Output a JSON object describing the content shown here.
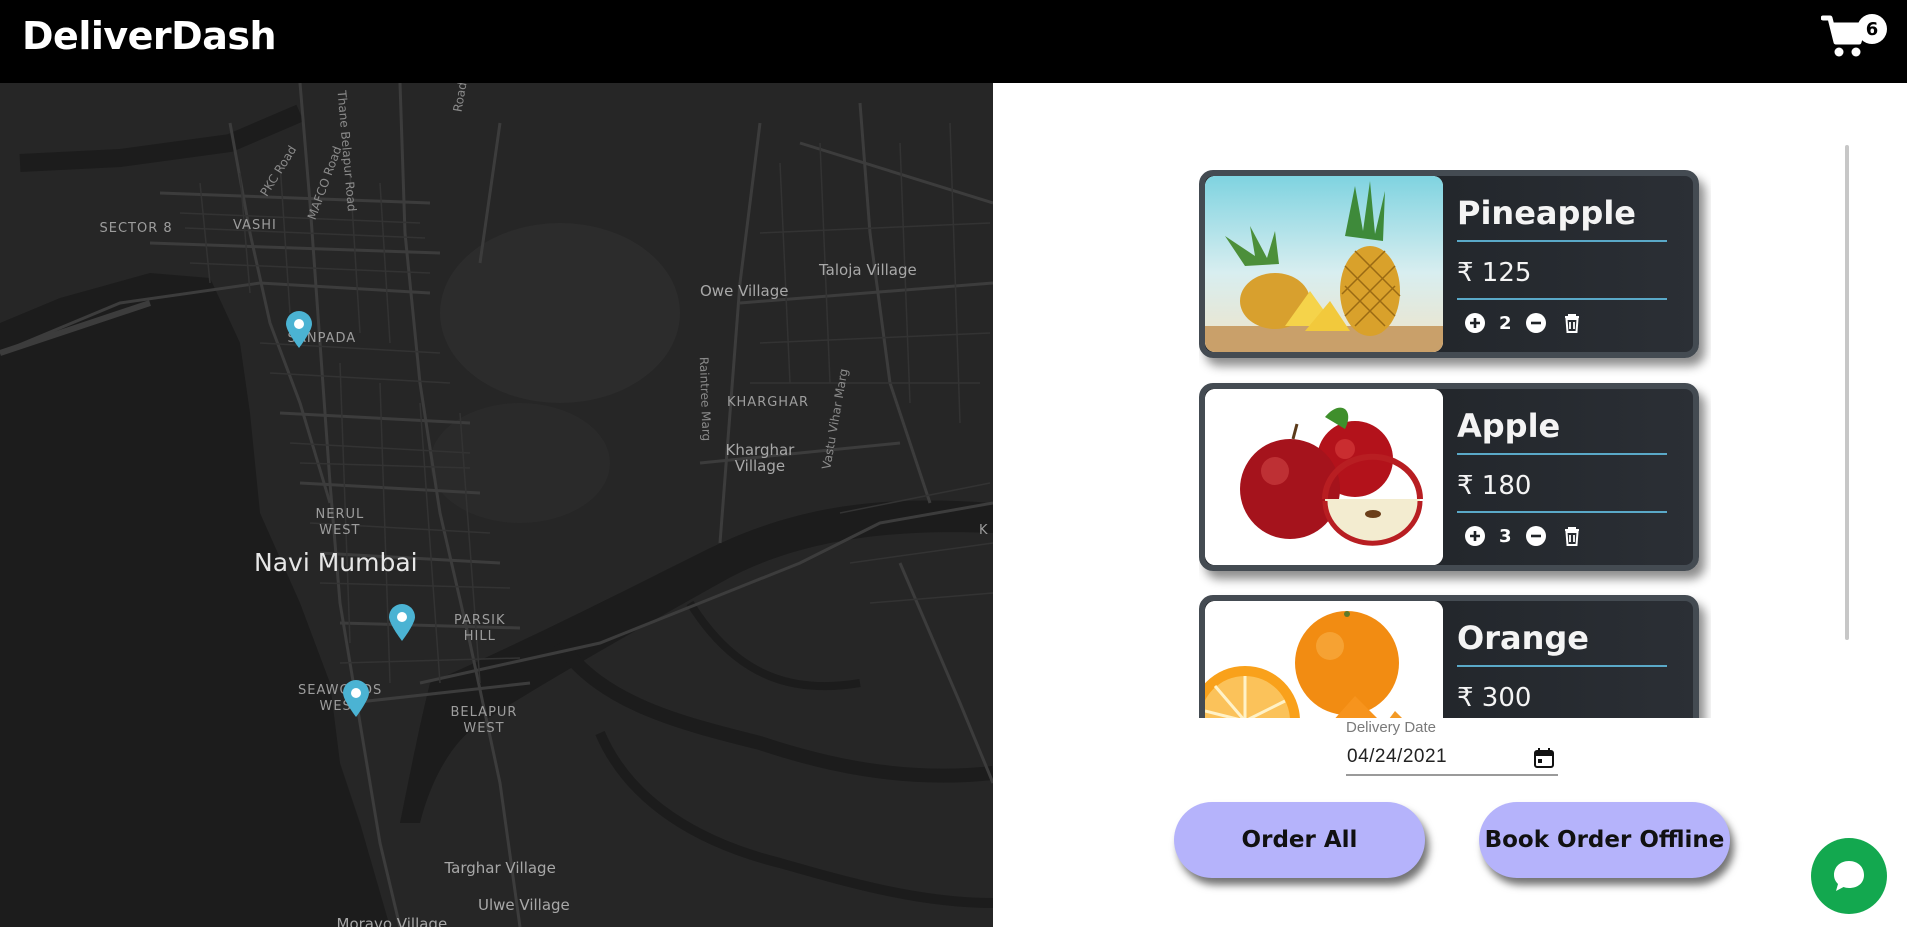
{
  "header": {
    "brand": "DeliverDash",
    "cart_count": "6"
  },
  "map": {
    "labels": {
      "sector8": "SECTOR 8",
      "vashi": "VASHI",
      "sanpada": "SANPADA",
      "nerul_line1": "NERUL",
      "nerul_line2": "WEST",
      "navi_mumbai": "Navi Mumbai",
      "parsik_line1": "PARSIK",
      "parsik_line2": "HILL",
      "seawoods_line1": "SEAWOODS",
      "seawoods_line2": "WEST",
      "belapur_line1": "BELAPUR",
      "belapur_line2": "WEST",
      "owe_village": "Owe Village",
      "taloja_village": "Taloja Village",
      "kharghar": "KHARGHAR",
      "kharghar_village_line1": "Kharghar",
      "kharghar_village_line2": "Village",
      "targhar_village": "Targhar Village",
      "ulwe_village": "Ulwe Village",
      "moravo_village": "Moravo Village",
      "pkc_road": "PKC Road",
      "mafco_road": "MAFCO Road",
      "thane_belapur_road": "Thane Belapur Road",
      "raintree_marg": "Raintree Marg",
      "vastu_vihar_marg": "Vastu Vihar Marg",
      "road_top": "Road",
      "edge_k": "K"
    }
  },
  "cart_items": [
    {
      "name": "Pineapple",
      "price": "₹ 125",
      "quantity": "2",
      "image": "pineapple-photo"
    },
    {
      "name": "Apple",
      "price": "₹ 180",
      "quantity": "3",
      "image": "apple-photo"
    },
    {
      "name": "Orange",
      "price": "₹ 300",
      "quantity": "",
      "image": "orange-photo"
    }
  ],
  "delivery": {
    "label": "Delivery Date",
    "value": "04/24/2021"
  },
  "actions": {
    "order_all": "Order All",
    "book_offline": "Book Order Offline"
  },
  "colors": {
    "header_bg": "#000000",
    "map_bg": "#262626",
    "button_bg": "#b5b3fb",
    "accent_line": "#5aa9c8",
    "pin": "#4bb3d3",
    "chat": "#13a84f"
  }
}
